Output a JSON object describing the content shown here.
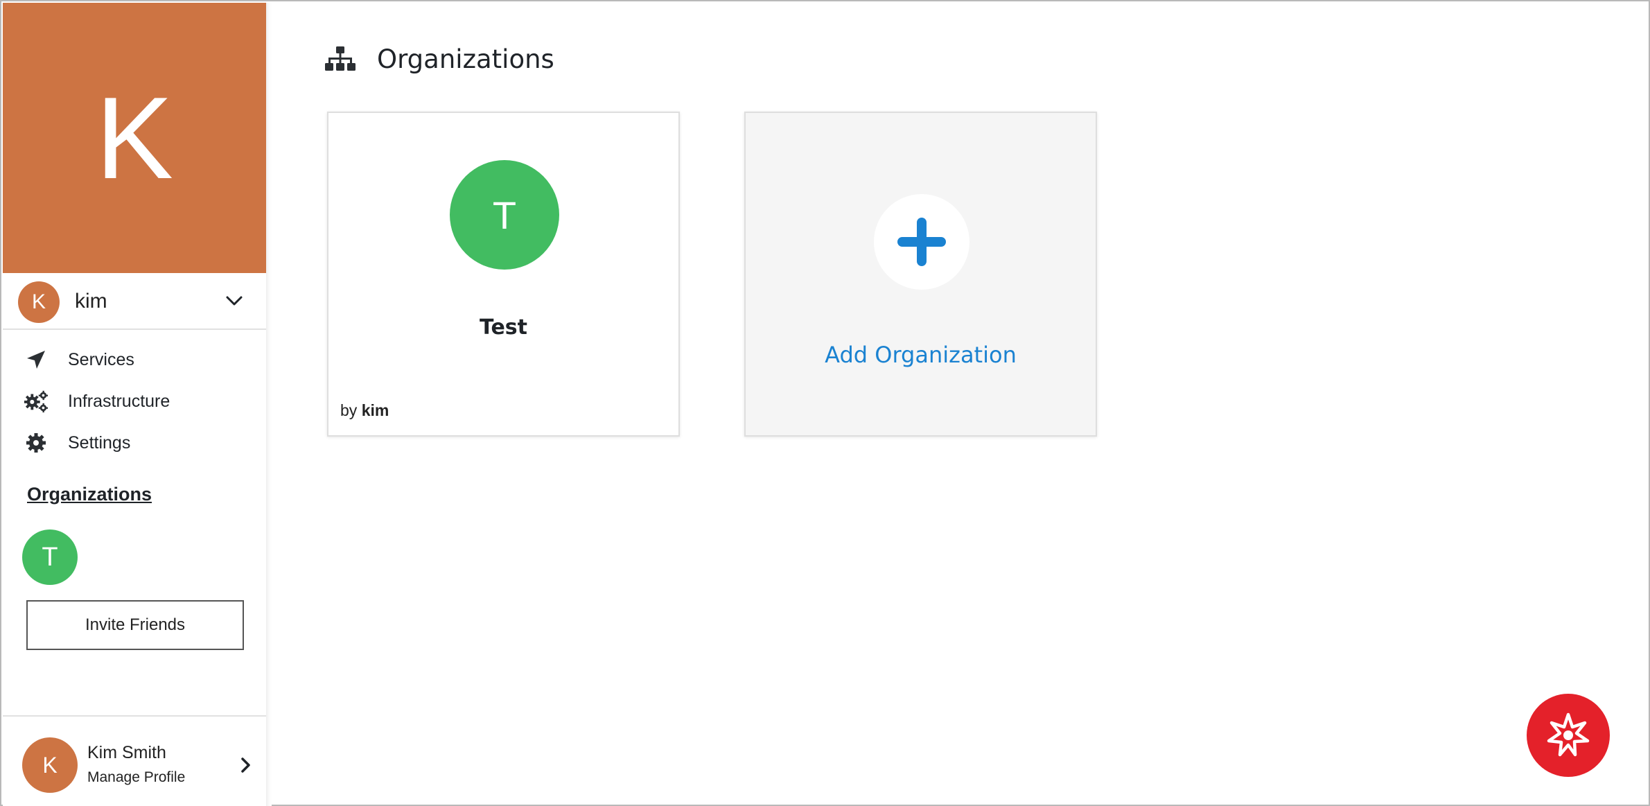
{
  "colors": {
    "user_accent": "#cd7443",
    "org_accent": "#42bc61",
    "link_blue": "#1a82d1",
    "fab_red": "#e4212a",
    "text_dark": "#1f2328"
  },
  "sidebar": {
    "hero_initial": "K",
    "user": {
      "initial": "K",
      "name": "kim",
      "toggle_icon": "chevron-down-icon"
    },
    "nav": [
      {
        "label": "Services",
        "icon": "paper-plane-icon"
      },
      {
        "label": "Infrastructure",
        "icon": "gears-icon"
      },
      {
        "label": "Settings",
        "icon": "gear-icon"
      }
    ],
    "organizations_heading": "Organizations",
    "organizations": [
      {
        "initial": "T"
      }
    ],
    "invite_label": "Invite Friends",
    "profile": {
      "initial": "K",
      "name": "Kim Smith",
      "subtitle": "Manage Profile",
      "chevron_icon": "chevron-right-icon"
    }
  },
  "main": {
    "title_icon": "sitemap-icon",
    "title": "Organizations",
    "org_cards": [
      {
        "initial": "T",
        "name": "Test",
        "by_prefix": "by",
        "owner": "kim"
      }
    ],
    "add_card": {
      "icon": "plus-icon",
      "label": "Add Organization"
    }
  },
  "fab": {
    "icon": "support-chat-icon"
  }
}
